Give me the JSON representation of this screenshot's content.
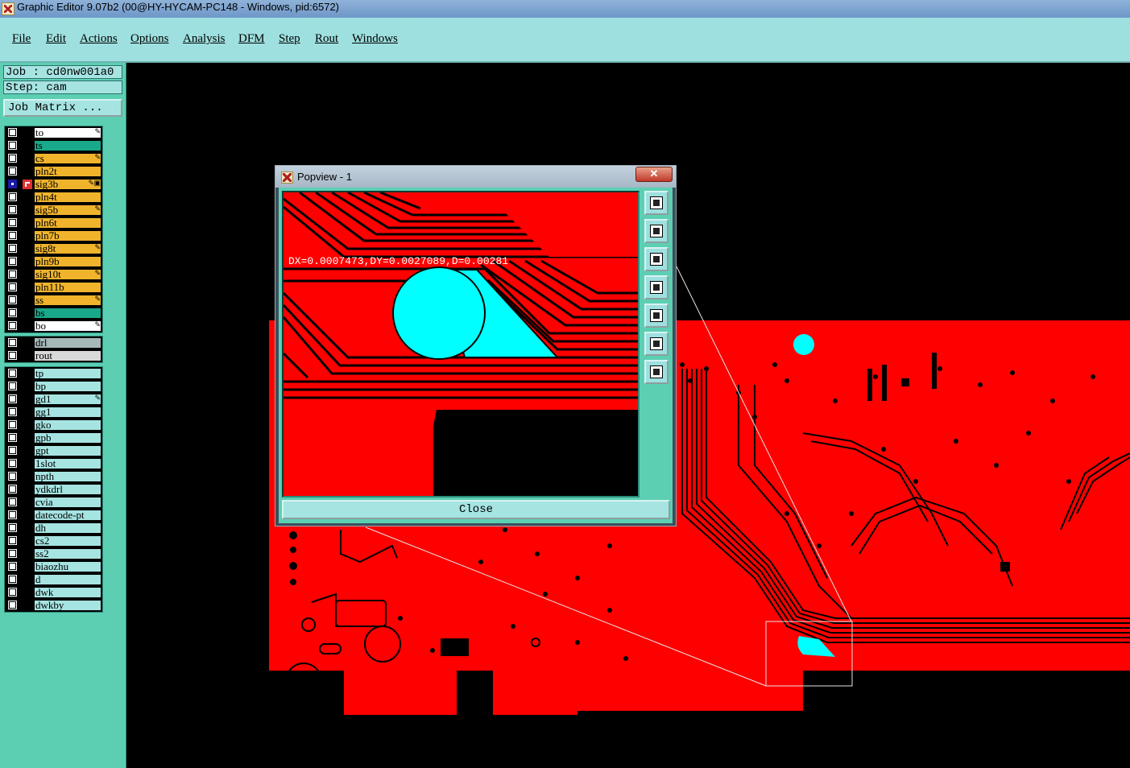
{
  "window": {
    "title": "Graphic Editor 9.07b2 (00@HY-HYCAM-PC148 - Windows, pid:6572)"
  },
  "menu": [
    "File",
    "Edit",
    "Actions",
    "Options",
    "Analysis",
    "DFM",
    "Step",
    "Rout",
    "Windows"
  ],
  "job": {
    "job_label": "Job : cd0nw001a0",
    "step_label": "Step: cam",
    "matrix_button": "Job Matrix ..."
  },
  "layers_board": [
    {
      "name": "to",
      "color": "#ffffff",
      "flag": "pen"
    },
    {
      "name": "ts",
      "color": "#1aa88a",
      "flag": ""
    },
    {
      "name": "cs",
      "color": "#f0b42c",
      "flag": "pen"
    },
    {
      "name": "pln2t",
      "color": "#f0b42c",
      "flag": ""
    },
    {
      "name": "sig3b",
      "color": "#f0b42c",
      "flag": "pen",
      "active": true
    },
    {
      "name": "pln4t",
      "color": "#f0b42c",
      "flag": ""
    },
    {
      "name": "sig5b",
      "color": "#f0b42c",
      "flag": "pen"
    },
    {
      "name": "pln6t",
      "color": "#f0b42c",
      "flag": ""
    },
    {
      "name": "pln7b",
      "color": "#f0b42c",
      "flag": ""
    },
    {
      "name": "sig8t",
      "color": "#f0b42c",
      "flag": "pen"
    },
    {
      "name": "pln9b",
      "color": "#f0b42c",
      "flag": ""
    },
    {
      "name": "sig10t",
      "color": "#f0b42c",
      "flag": "pen"
    },
    {
      "name": "pln11b",
      "color": "#f0b42c",
      "flag": ""
    },
    {
      "name": "ss",
      "color": "#f0b42c",
      "flag": "pen"
    },
    {
      "name": "bs",
      "color": "#1aa88a",
      "flag": ""
    },
    {
      "name": "bo",
      "color": "#ffffff",
      "flag": "pen"
    }
  ],
  "layers_drill": [
    {
      "name": "drl",
      "color": "#a6b8b8",
      "flag": ""
    },
    {
      "name": "rout",
      "color": "#d9d9d9",
      "flag": ""
    }
  ],
  "layers_misc": [
    {
      "name": "tp",
      "color": "#a6e4e2",
      "flag": ""
    },
    {
      "name": "bp",
      "color": "#a6e4e2",
      "flag": ""
    },
    {
      "name": "gd1",
      "color": "#a6e4e2",
      "flag": "pen"
    },
    {
      "name": "gg1",
      "color": "#a6e4e2",
      "flag": ""
    },
    {
      "name": "gko",
      "color": "#a6e4e2",
      "flag": ""
    },
    {
      "name": "gpb",
      "color": "#a6e4e2",
      "flag": ""
    },
    {
      "name": "gpt",
      "color": "#a6e4e2",
      "flag": ""
    },
    {
      "name": "1slot",
      "color": "#a6e4e2",
      "flag": ""
    },
    {
      "name": "npth",
      "color": "#a6e4e2",
      "flag": ""
    },
    {
      "name": "ydkdrl",
      "color": "#a6e4e2",
      "flag": ""
    },
    {
      "name": "cvia",
      "color": "#a6e4e2",
      "flag": ""
    },
    {
      "name": "datecode-pt",
      "color": "#a6e4e2",
      "flag": ""
    },
    {
      "name": "dh",
      "color": "#a6e4e2",
      "flag": ""
    },
    {
      "name": "cs2",
      "color": "#a6e4e2",
      "flag": ""
    },
    {
      "name": "ss2",
      "color": "#a6e4e2",
      "flag": ""
    },
    {
      "name": "biaozhu",
      "color": "#a6e4e2",
      "flag": ""
    },
    {
      "name": "d",
      "color": "#a6e4e2",
      "flag": ""
    },
    {
      "name": "dwk",
      "color": "#a6e4e2",
      "flag": ""
    },
    {
      "name": "dwkby",
      "color": "#a6e4e2",
      "flag": ""
    }
  ],
  "popview": {
    "title": "Popview - 1",
    "close_x": "✕",
    "measurement": "DX=0.0007473,DY=0.0027089,D=0.00281",
    "close_button": "Close",
    "tools": [
      "zoom-home-icon",
      "pan-up-icon",
      "pan-down-icon",
      "pan-left-icon",
      "pan-right-icon",
      "zoom-fit-icon",
      "zoom-center-icon"
    ]
  },
  "colors": {
    "copper": "#ff0000",
    "pad": "#00ffff",
    "background": "#000000",
    "panel": "#5ccfb3"
  }
}
